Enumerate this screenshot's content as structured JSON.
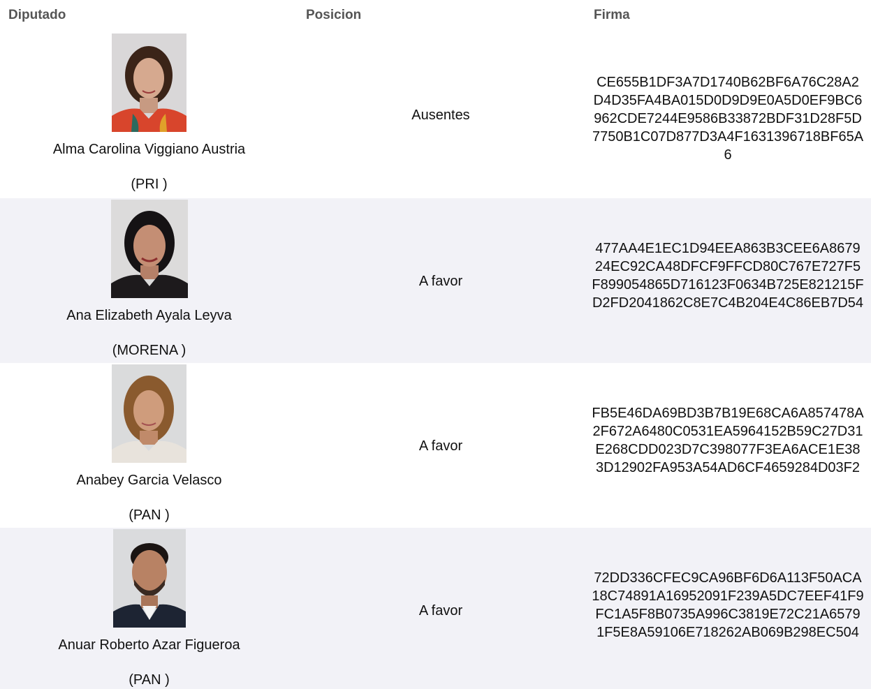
{
  "headers": {
    "diputado": "Diputado",
    "posicion": "Posicion",
    "firma": "Firma"
  },
  "rows": [
    {
      "name": "Alma Carolina Viggiano Austria",
      "party": "(PRI )",
      "position": "Ausentes",
      "firma": "CE655B1DF3A7D1740B62BF6A76C28A2D4D35FA4BA015D0D9D9E0A5D0EF9BC6962CDE7244E9586B33872BDF31D28F5D7750B1C07D877D3A4F1631396718BF65A6"
    },
    {
      "name": "Ana Elizabeth Ayala Leyva",
      "party": "(MORENA )",
      "position": "A favor",
      "firma": "477AA4E1EC1D94EEA863B3CEE6A867924EC92CA48DFCF9FFCD80C767E727F5F899054865D716123F0634B725E821215FD2FD2041862C8E7C4B204E4C86EB7D54"
    },
    {
      "name": "Anabey Garcia Velasco",
      "party": "(PAN )",
      "position": "A favor",
      "firma": "FB5E46DA69BD3B7B19E68CA6A857478A2F672A6480C0531EA5964152B59C27D31E268CDD023D7C398077F3EA6ACE1E383D12902FA953A54AD6CF4659284D03F2"
    },
    {
      "name": "Anuar Roberto Azar Figueroa",
      "party": "(PAN )",
      "position": "A favor",
      "firma": "72DD336CFEC9CA96BF6D6A113F50ACA18C74891A16952091F239A5DC7EEF41F9FC1A5F8B0735A996C3819E72C21A65791F5E8A59106E718262AB069B298EC504"
    }
  ]
}
